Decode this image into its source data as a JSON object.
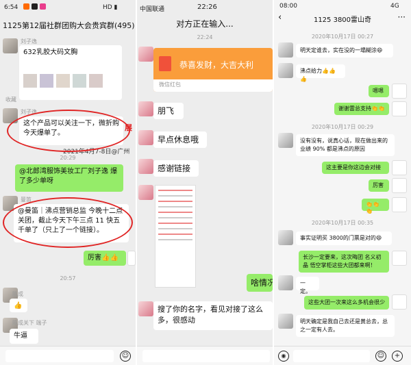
{
  "left_panel": {
    "status_time": "6:54",
    "status_right": "HD ▮",
    "chat_title": "1125第12届社群团购大会贵宾群(495)",
    "sender_1": "刘子逸",
    "msg_1": "632乳胶大码文胸",
    "collect_label": "收藏",
    "sender_2": "刘子逸",
    "msg_2": "这个产品可以关注一下，微折购今天爆单了。",
    "overlay_date": "2021年4月7-8日@广州",
    "overlay_red_char": "展",
    "time_1": "20:29",
    "msg_3": "@北郎湾服饰美妆工厂刘子逸  爆了多少单呀",
    "sender_3": "曼笛",
    "msg_4": "@曼笛｜沸点营销总监  今晚十二点关团，截止今天下午三点 11 快五千单了（只上了一个链接）。",
    "msg_5": "厉害👍👍",
    "time_2": "20:57",
    "sender_4": "陈成",
    "msg_6": "👍",
    "sender_5": "陈成关下 端子",
    "msg_7": "牛逼"
  },
  "middle_panel": {
    "status_carrier": "中国联通",
    "status_time": "22:26",
    "chat_title": "对方正在输入...",
    "time_1": "22:24",
    "redpacket_text": "恭喜发财，大吉大利",
    "redpacket_label": "微信红包",
    "msg_1": "朋飞",
    "msg_2": "早点休息哦",
    "msg_3": "感谢链接",
    "msg_4": "啥情况",
    "msg_5": "搜了你的名字，看见对接了这么多，很感动"
  },
  "right_panel": {
    "status_time": "08:00",
    "status_right": "4G",
    "chat_title": "1125  3800雷山奇",
    "time_1": "2020年10月17日 00:27",
    "msg_1": "明天定谁去，实在没的一塌糊涂😄",
    "msg_2": "沸点给力👍👍👍",
    "msg_3": "嗯嗯",
    "msg_4": "谢谢雷总支持👏👏",
    "time_2": "2020年10月17日 00:29",
    "msg_5": "没有没有，说真心话，现在做出来的业绩 90% 都是沸点的原因",
    "msg_6": "这主要是你这边会对接",
    "msg_7": "厉害",
    "msg_8": "👏👏👏",
    "time_3": "2020年10月17日 00:35",
    "msg_9": "事实证明买 3800的门票是对的😄",
    "msg_10": "长沙一定要来，这次晦团 名义初晶 悟空掌柜这些大团都来啊！",
    "msg_11": "一定。",
    "msg_12": "这些大团一次来这么多机会很少",
    "msg_13": "明天确定是我自己去还是黄总去，总之一定有人去。"
  }
}
